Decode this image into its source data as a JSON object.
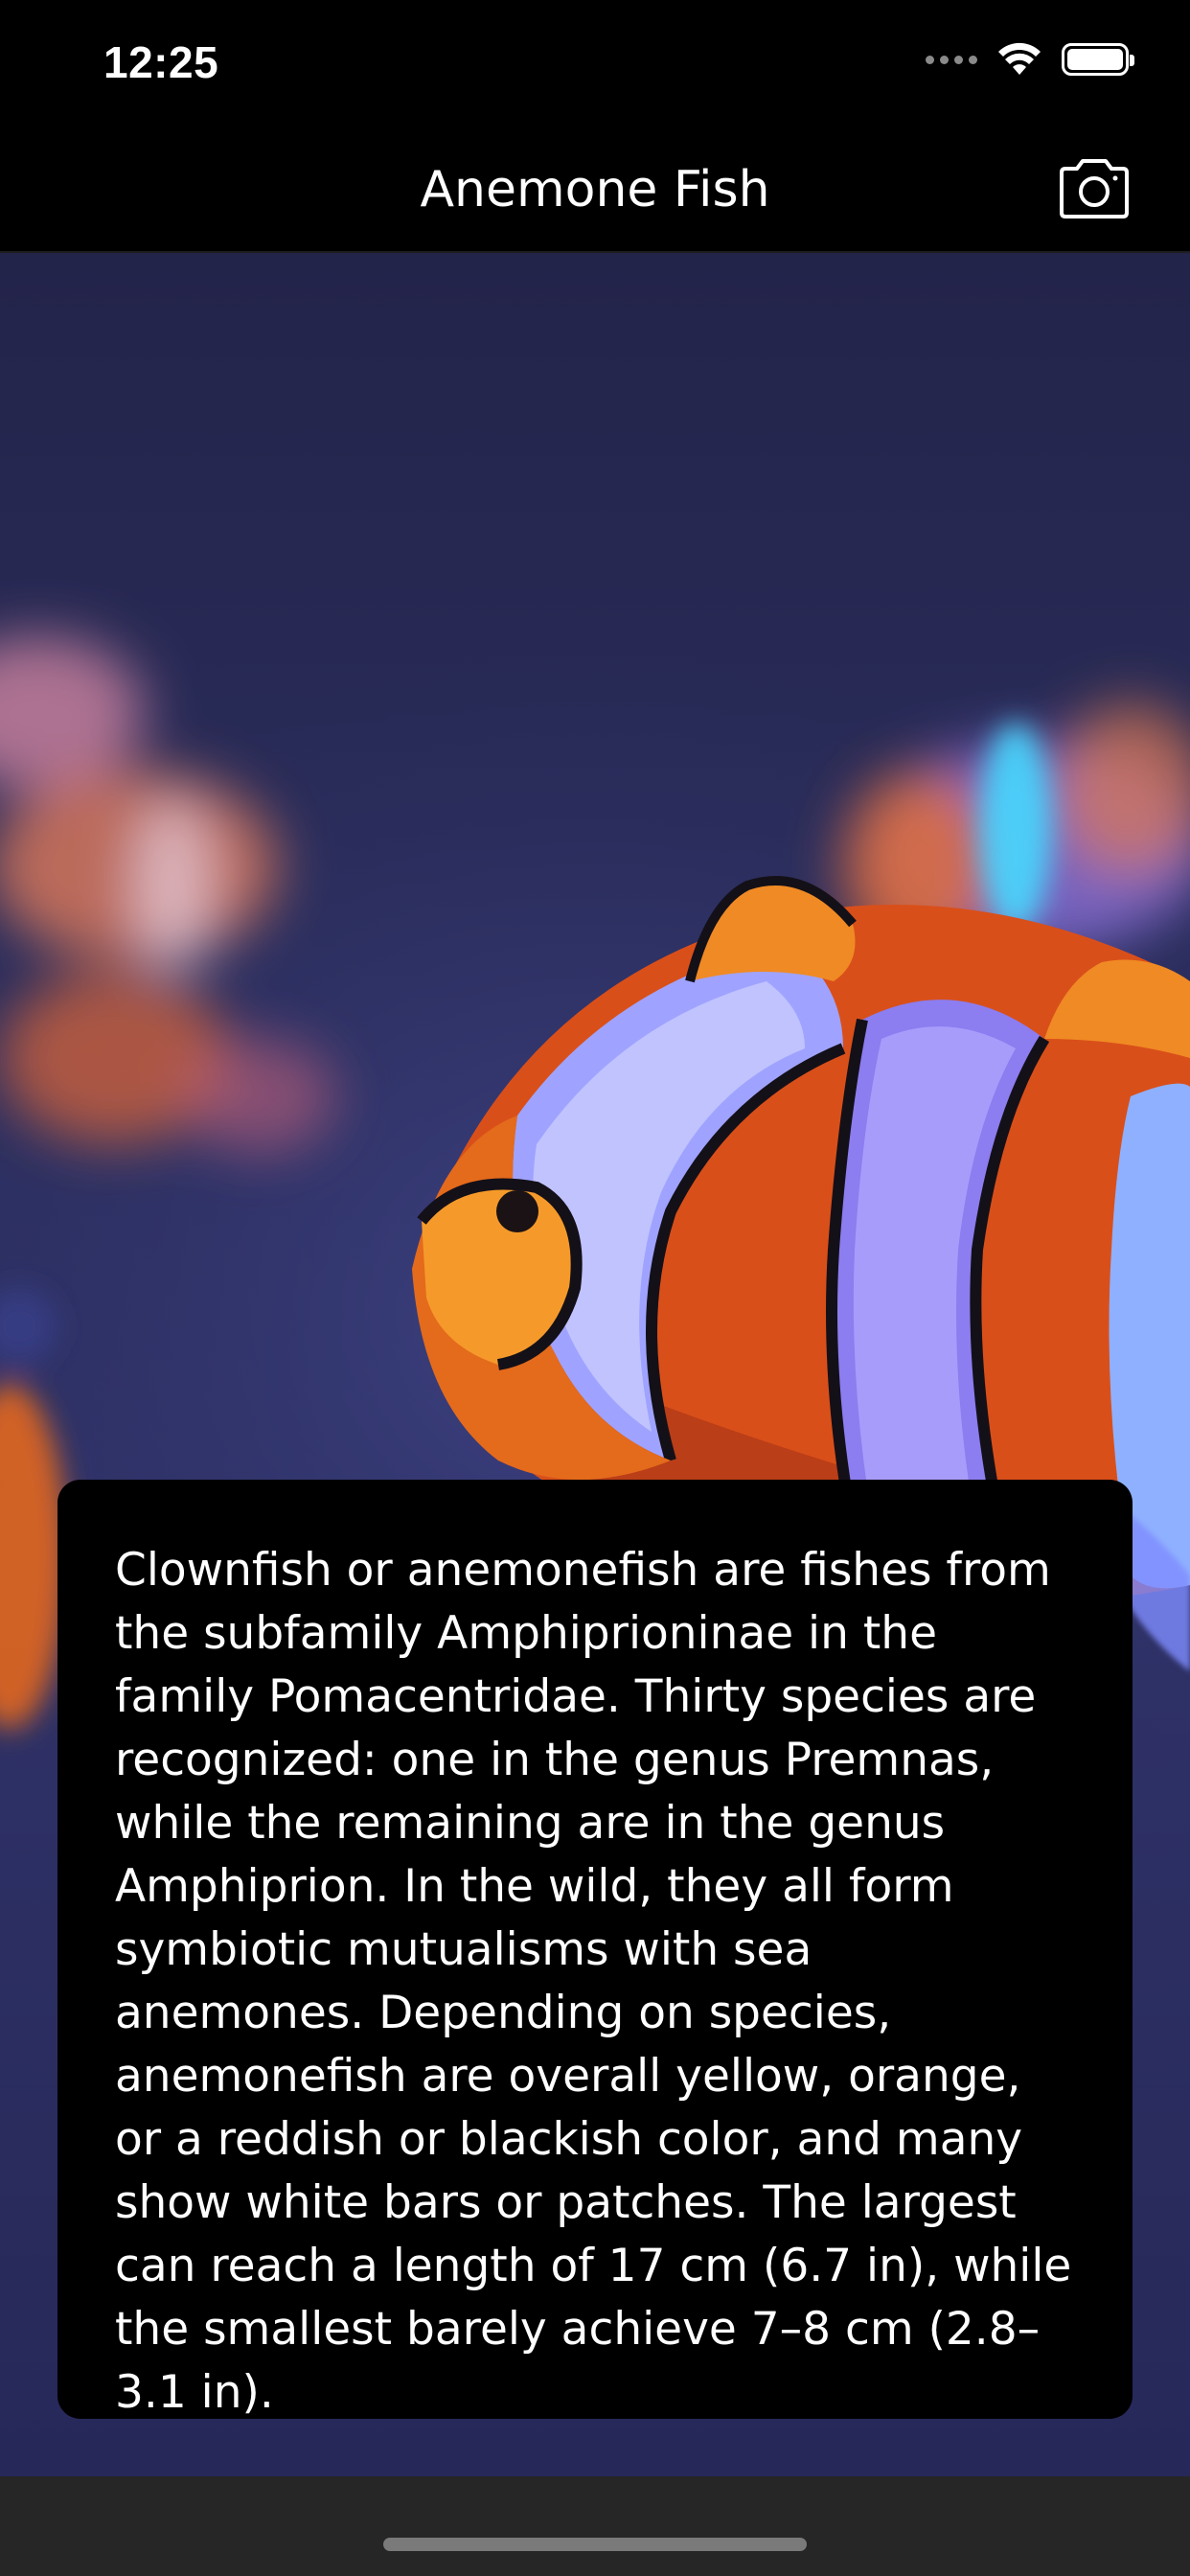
{
  "status_bar": {
    "time": "12:25"
  },
  "nav": {
    "title": "Anemone Fish",
    "camera_icon": "camera-icon"
  },
  "photo": {
    "subject": "clownfish-photo"
  },
  "description": {
    "text": "Clownfish or anemonefish are fishes from the subfamily Amphiprioninae in the family Pomacentridae. Thirty species are recognized: one in the genus Premnas, while the remaining are in the genus Amphiprion. In the wild, they all form symbiotic mutualisms with sea anemones. Depending on species, anemonefish are overall yellow, orange, or a reddish or blackish color, and many show white bars or patches. The largest can reach a length of 17 cm (6.7 in), while the smallest barely achieve 7–8 cm (2.8–3.1 in)."
  },
  "colors": {
    "background": "#000000",
    "card": "#000000",
    "water": "#2b2e5e",
    "fish_orange": "#e0601c",
    "fish_white": "#b6b8ff"
  }
}
